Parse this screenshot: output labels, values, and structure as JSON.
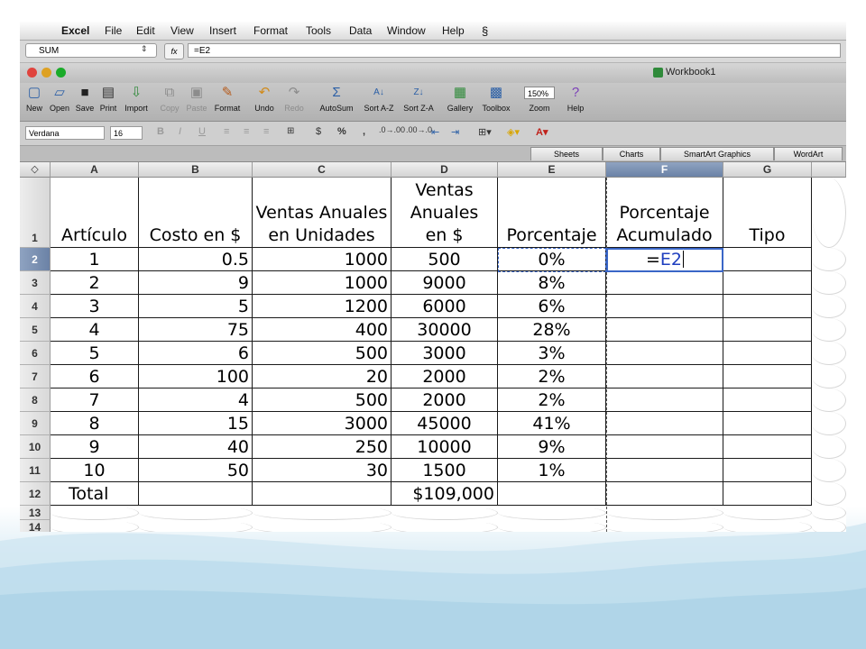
{
  "menubar": {
    "apple": "",
    "items": [
      "Excel",
      "File",
      "Edit",
      "View",
      "Insert",
      "Format",
      "Tools",
      "Data",
      "Window",
      "Help"
    ],
    "script_icon": "script-menu-icon"
  },
  "formula_bar": {
    "name_box": "SUM",
    "fx_label": "fx",
    "formula": "=E2"
  },
  "window": {
    "title": "Workbook1",
    "traffic_lights": [
      "#e0443e",
      "#dea123",
      "#1aab29"
    ]
  },
  "toolbar": {
    "buttons": [
      {
        "label": "New",
        "icon": "new-document-icon",
        "enabled": true
      },
      {
        "label": "Open",
        "icon": "open-folder-icon",
        "enabled": true
      },
      {
        "label": "Save",
        "icon": "save-icon",
        "enabled": true
      },
      {
        "label": "Print",
        "icon": "print-icon",
        "enabled": true
      },
      {
        "label": "Import",
        "icon": "import-icon",
        "enabled": true
      },
      {
        "label": "Copy",
        "icon": "copy-icon",
        "enabled": false
      },
      {
        "label": "Paste",
        "icon": "paste-icon",
        "enabled": false
      },
      {
        "label": "Format",
        "icon": "format-brush-icon",
        "enabled": true
      },
      {
        "label": "Undo",
        "icon": "undo-icon",
        "enabled": true
      },
      {
        "label": "Redo",
        "icon": "redo-icon",
        "enabled": false
      },
      {
        "label": "AutoSum",
        "icon": "autosum-icon",
        "enabled": true
      },
      {
        "label": "Sort A-Z",
        "icon": "sort-ascending-icon",
        "enabled": true
      },
      {
        "label": "Sort Z-A",
        "icon": "sort-descending-icon",
        "enabled": true
      },
      {
        "label": "Gallery",
        "icon": "gallery-icon",
        "enabled": true
      },
      {
        "label": "Toolbox",
        "icon": "toolbox-icon",
        "enabled": true
      },
      {
        "label": "Zoom",
        "icon": "zoom-icon",
        "enabled": true
      },
      {
        "label": "Help",
        "icon": "help-icon",
        "enabled": true
      }
    ],
    "zoom_value": "150%"
  },
  "format_bar": {
    "font": "Verdana",
    "size": "16",
    "bold": "B",
    "italic": "I",
    "underline": "U",
    "percent": "%",
    "comma": ","
  },
  "ribbon_tabs": [
    "Sheets",
    "Charts",
    "SmartArt Graphics",
    "WordArt"
  ],
  "sheet": {
    "corner": "◇",
    "columns": [
      "A",
      "B",
      "C",
      "D",
      "E",
      "F",
      "G"
    ],
    "selected_column": "F",
    "row_numbers": [
      "1",
      "2",
      "3",
      "4",
      "5",
      "6",
      "7",
      "8",
      "9",
      "10",
      "11",
      "12",
      "13",
      "14"
    ],
    "selected_row": "2",
    "headers": {
      "A": "Artículo",
      "B": "Costo en $",
      "C": "Ventas Anuales en Unidades",
      "D": "Ventas Anuales en $",
      "E": "Porcentaje",
      "F": "Porcentaje Acumulado",
      "G": "Tipo"
    },
    "rows": [
      {
        "A": "1",
        "B": "0.5",
        "C": "1000",
        "D": "500",
        "E": "0%"
      },
      {
        "A": "2",
        "B": "9",
        "C": "1000",
        "D": "9000",
        "E": "8%"
      },
      {
        "A": "3",
        "B": "5",
        "C": "1200",
        "D": "6000",
        "E": "6%"
      },
      {
        "A": "4",
        "B": "75",
        "C": "400",
        "D": "30000",
        "E": "28%"
      },
      {
        "A": "5",
        "B": "6",
        "C": "500",
        "D": "3000",
        "E": "3%"
      },
      {
        "A": "6",
        "B": "100",
        "C": "20",
        "D": "2000",
        "E": "2%"
      },
      {
        "A": "7",
        "B": "4",
        "C": "500",
        "D": "2000",
        "E": "2%"
      },
      {
        "A": "8",
        "B": "15",
        "C": "3000",
        "D": "45000",
        "E": "41%"
      },
      {
        "A": "9",
        "B": "40",
        "C": "250",
        "D": "10000",
        "E": "9%"
      },
      {
        "A": "10",
        "B": "50",
        "C": "30",
        "D": "1500",
        "E": "1%"
      }
    ],
    "total_label": "Total",
    "total_value": "$109,000",
    "editing_cell": {
      "prefix": "=",
      "reference": "E2",
      "reference_color": "#1f3fbf"
    }
  }
}
